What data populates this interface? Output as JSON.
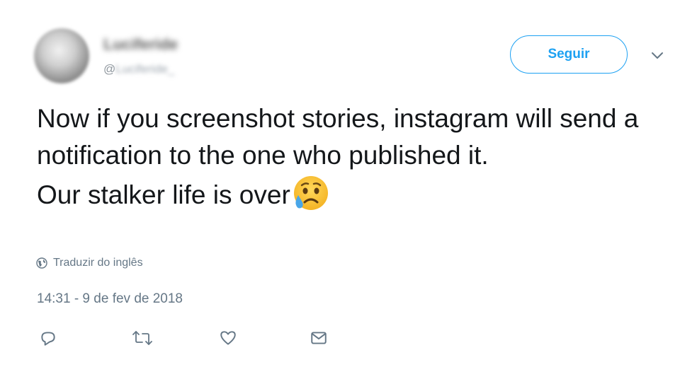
{
  "tweet": {
    "display_name": "Luciferide",
    "username_prefix": "@",
    "username": "Luciferide_",
    "follow_label": "Seguir",
    "text_lines": [
      "Now if you screenshot stories, instagram will send a notification to the one who published it.",
      "Our stalker life is over"
    ],
    "emoji_name": "sad-but-relieved-face-icon",
    "translate_label": "Traduzir do inglês",
    "timestamp": "14:31 - 9 de fev de 2018"
  },
  "colors": {
    "accent": "#1da1f2",
    "text": "#14171a",
    "secondary": "#657786"
  },
  "icons": {
    "menu": "chevron-down-icon",
    "translate": "globe-icon",
    "reply": "reply-icon",
    "retweet": "retweet-icon",
    "like": "heart-icon",
    "message": "envelope-icon"
  }
}
